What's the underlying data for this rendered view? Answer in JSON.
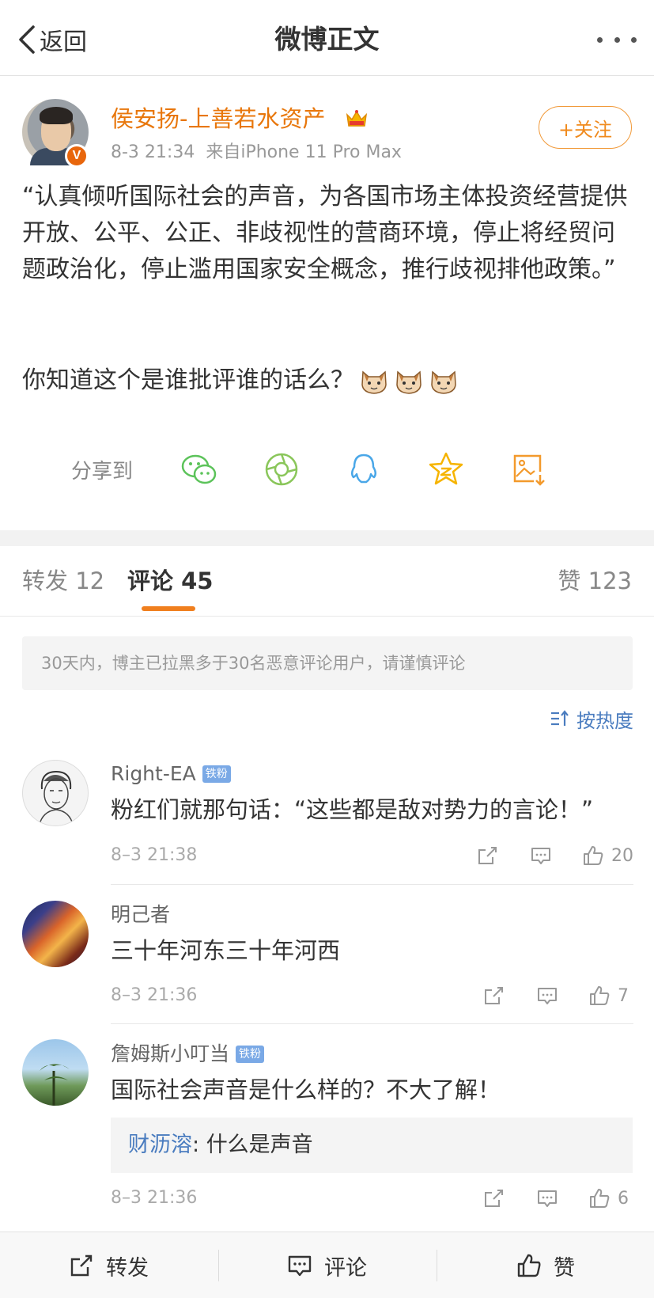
{
  "nav": {
    "back_label": "返回",
    "title": "微博正文",
    "more_icon": "more-icon"
  },
  "post": {
    "author": "侯安扬-上善若水资产",
    "verified_badge": "V",
    "time": "8-3 21:34",
    "source": "来自iPhone 11 Pro Max",
    "follow_label": "+关注",
    "text": "“认真倾听国际社会的声音，为各国市场主体投资经营提供开放、公平、公正、非歧视性的营商环境，停止将经贸问题政治化，停止滥用国家安全概念，推行歧视排他政策。”",
    "question": "你知道这个是谁批评谁的话么？",
    "emoji_count": 3
  },
  "share": {
    "label": "分享到",
    "targets": [
      "wechat-icon",
      "moments-icon",
      "qq-icon",
      "qzone-icon",
      "save-image-icon"
    ]
  },
  "tabs": {
    "repost_label": "转发",
    "repost_count": "12",
    "comment_label": "评论",
    "comment_count": "45",
    "like_label": "赞",
    "like_count": "123"
  },
  "notice": "30天内，博主已拉黑多于30名恶意评论用户，请谨慎评论",
  "sort_label": "按热度",
  "comments": [
    {
      "user": "Right-EA",
      "badge": "铁粉",
      "text": "粉红们就那句话：“这些都是敌对势力的言论！”",
      "time": "8–3 21:38",
      "likes": "20"
    },
    {
      "user": "明己者",
      "badge": "",
      "text": "三十年河东三十年河西",
      "time": "8–3 21:36",
      "likes": "7"
    },
    {
      "user": "詹姆斯小叮当",
      "badge": "铁粉",
      "text": "国际社会声音是什么样的？不大了解！",
      "time": "8–3 21:36",
      "likes": "6",
      "reply": {
        "user": "财沥溶",
        "separator": ": ",
        "text": "什么是声音"
      }
    }
  ],
  "bottom_bar": {
    "repost": "转发",
    "comment": "评论",
    "like": "赞"
  },
  "colors": {
    "accent_orange": "#f07f1e",
    "author_orange": "#e8770c",
    "link_blue": "#4a7cbf",
    "wechat_green": "#5cc35a",
    "qq_blue": "#4aa7e8",
    "qzone_yellow": "#f6b400"
  }
}
